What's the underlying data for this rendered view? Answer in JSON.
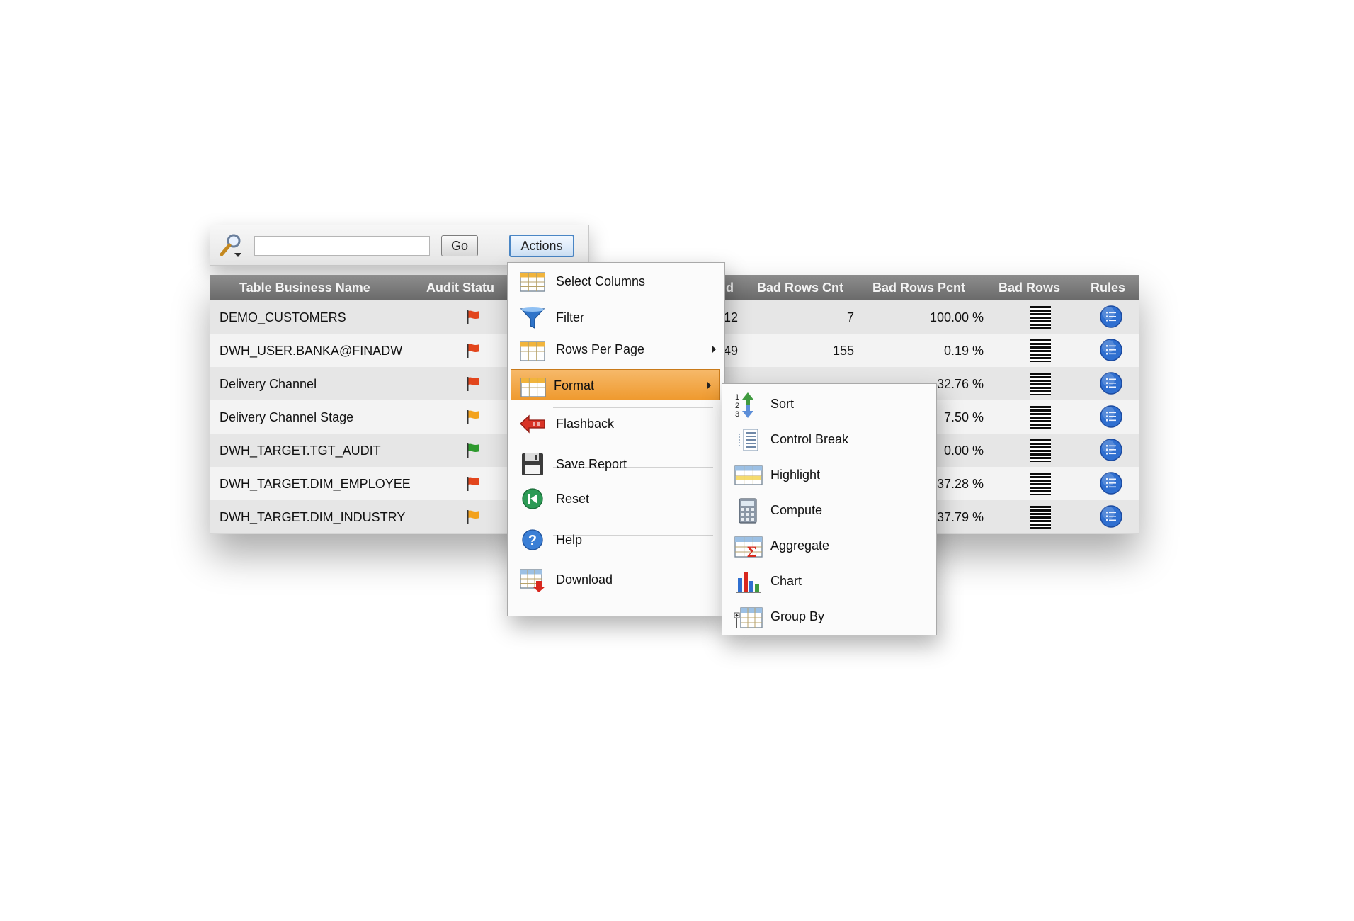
{
  "toolbar": {
    "search_value": "",
    "go_label": "Go",
    "actions_label": "Actions"
  },
  "table": {
    "headers": [
      "Table Business Name",
      "Audit Statu",
      "d",
      "Bad Rows Cnt",
      "Bad Rows Pcnt",
      "Bad Rows",
      "Rules"
    ],
    "rows": [
      {
        "name": "DEMO_CUSTOMERS",
        "flag": "red",
        "c3": "12",
        "cnt": "7",
        "pcnt": "100.00 %"
      },
      {
        "name": "DWH_USER.BANKA@FINADW",
        "flag": "red",
        "c3": "49",
        "cnt": "155",
        "pcnt": "0.19 %"
      },
      {
        "name": "Delivery Channel",
        "flag": "red",
        "c3": "",
        "cnt": "",
        "pcnt": "32.76 %"
      },
      {
        "name": "Delivery Channel Stage",
        "flag": "orange",
        "c3": "",
        "cnt": "",
        "pcnt": "7.50 %"
      },
      {
        "name": "DWH_TARGET.TGT_AUDIT",
        "flag": "green",
        "c3": "",
        "cnt": "",
        "pcnt": "0.00 %"
      },
      {
        "name": "DWH_TARGET.DIM_EMPLOYEE",
        "flag": "red",
        "c3": "",
        "cnt": "",
        "pcnt": "37.28 %"
      },
      {
        "name": "DWH_TARGET.DIM_INDUSTRY",
        "flag": "orange",
        "c3": "",
        "cnt": "",
        "pcnt": "37.79 %"
      }
    ]
  },
  "actions_menu": {
    "items": [
      {
        "label": "Select Columns",
        "icon": "select-columns-icon"
      },
      {
        "label": "Filter",
        "icon": "filter-icon"
      },
      {
        "label": "Rows Per Page",
        "icon": "rows-per-page-icon",
        "submenu": true
      },
      {
        "label": "Format",
        "icon": "format-icon",
        "submenu": true,
        "highlighted": true
      },
      {
        "label": "Flashback",
        "icon": "flashback-icon"
      },
      {
        "label": "Save Report",
        "icon": "save-icon"
      },
      {
        "label": "Reset",
        "icon": "reset-icon"
      },
      {
        "label": "Help",
        "icon": "help-icon"
      },
      {
        "label": "Download",
        "icon": "download-icon"
      }
    ]
  },
  "format_submenu": {
    "items": [
      {
        "label": "Sort",
        "icon": "sort-icon"
      },
      {
        "label": "Control Break",
        "icon": "control-break-icon"
      },
      {
        "label": "Highlight",
        "icon": "highlight-icon"
      },
      {
        "label": "Compute",
        "icon": "compute-icon"
      },
      {
        "label": "Aggregate",
        "icon": "aggregate-icon"
      },
      {
        "label": "Chart",
        "icon": "chart-icon"
      },
      {
        "label": "Group By",
        "icon": "group-by-icon"
      }
    ]
  },
  "colors": {
    "flag_red": "#e2451c",
    "flag_orange": "#f3a21d",
    "flag_green": "#2e9a2e",
    "menu_highlight": "#ef9a2f",
    "rules_blue": "#2f6fd0"
  }
}
